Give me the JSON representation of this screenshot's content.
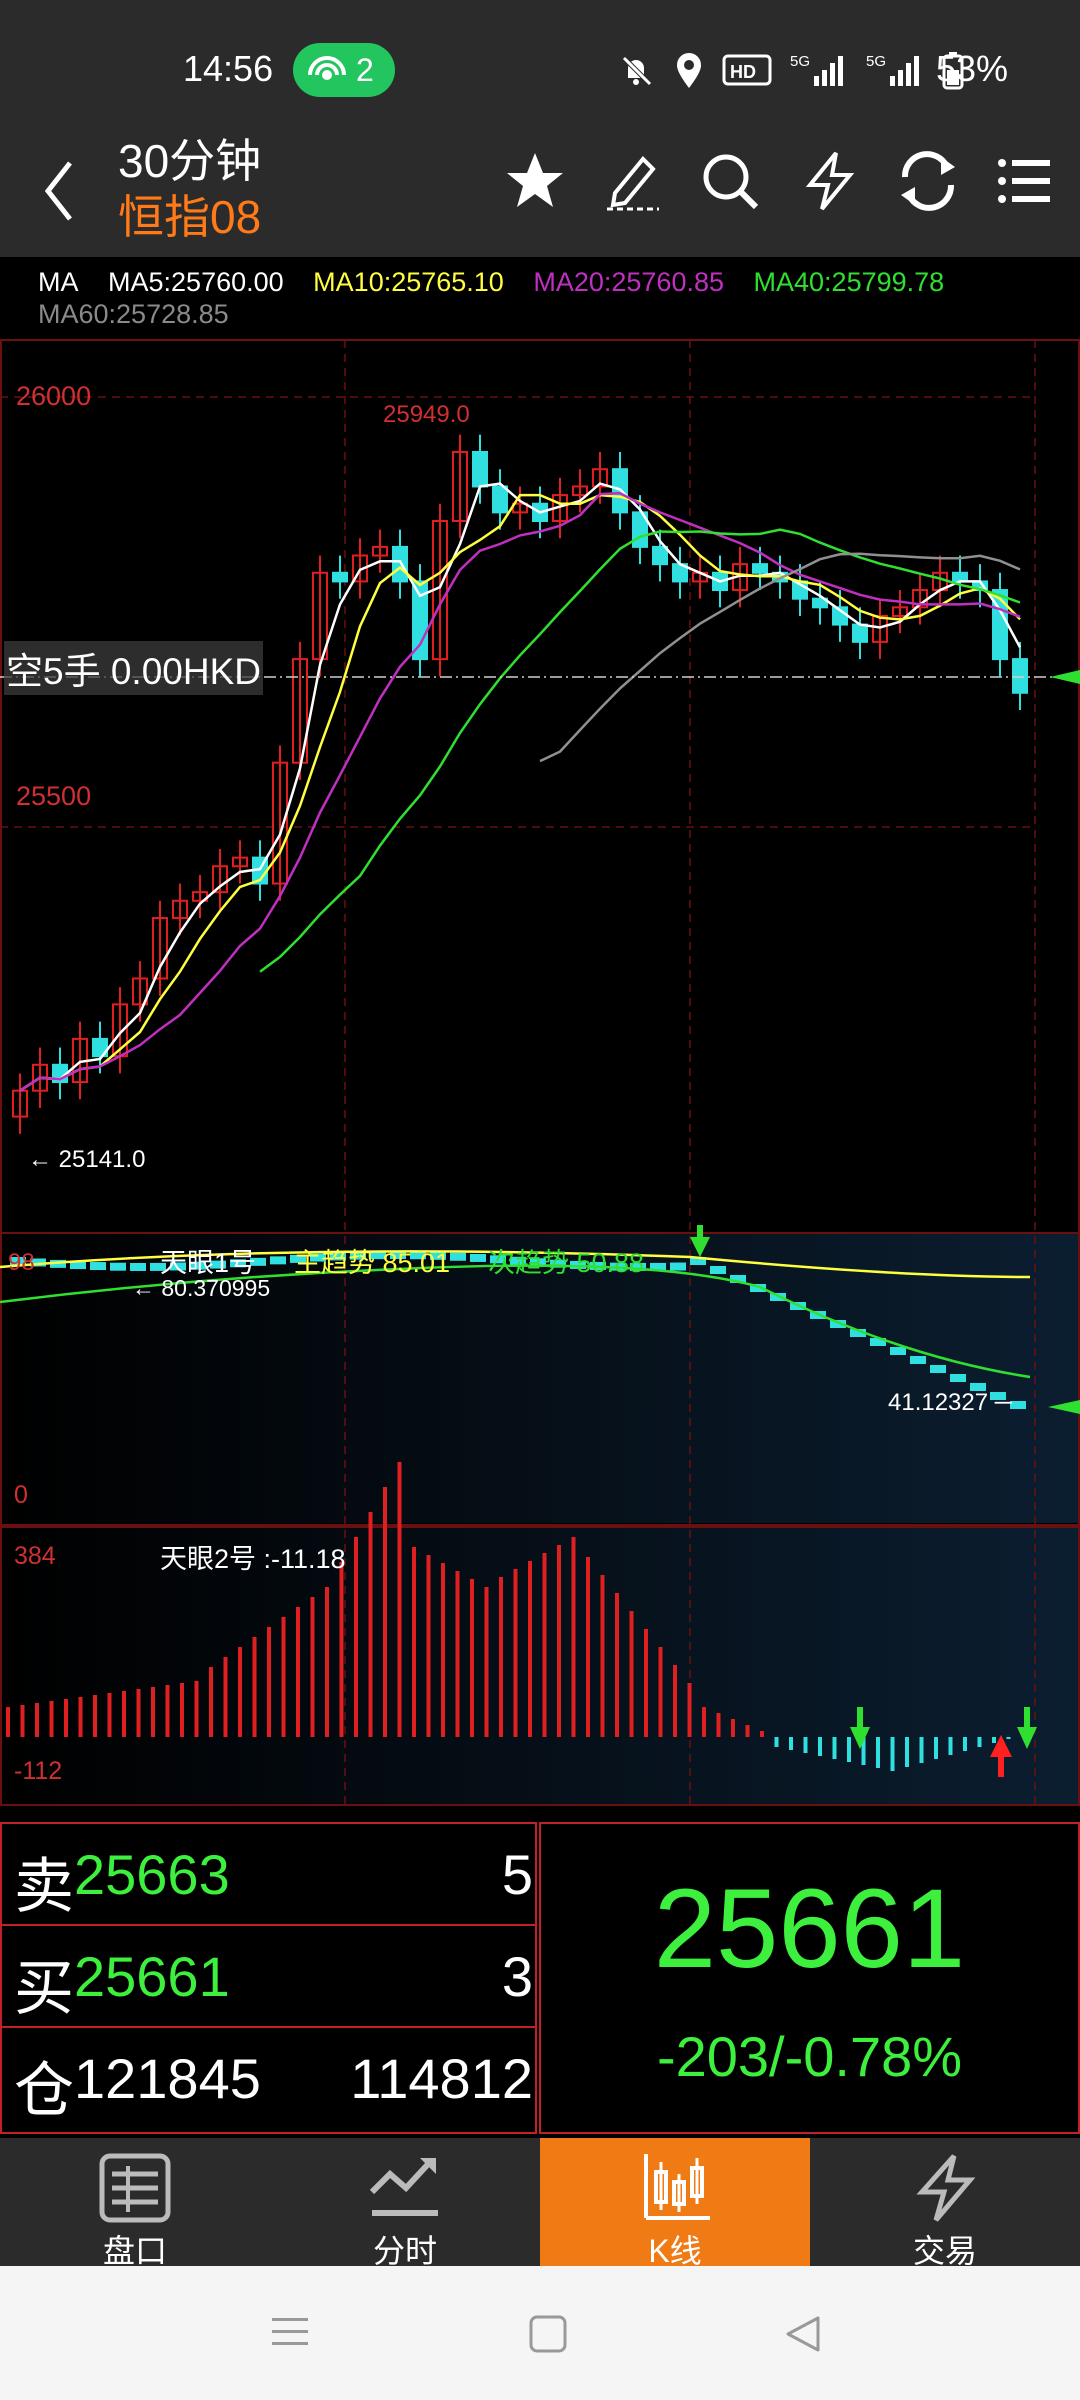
{
  "status_bar": {
    "time": "14:56",
    "hotspot_count": "2",
    "network": "HD 5G 5G",
    "battery": "53%"
  },
  "header": {
    "title": "30分钟",
    "subtitle": "恒指08"
  },
  "ma_legend": {
    "label": "MA",
    "ma5": "MA5:25760.00",
    "ma10": "MA10:25765.10",
    "ma20": "MA20:25760.85",
    "ma40": "MA40:25799.78",
    "ma60": "MA60:25728.85",
    "colors": {
      "ma5": "#ffffff",
      "ma10": "#ffff40",
      "ma20": "#c030c0",
      "ma40": "#30e030",
      "ma60": "#909090"
    }
  },
  "main_chart": {
    "y_top_label": "26000",
    "y_mid_label": "25500",
    "high_label": "25949.0",
    "low_label": "← 25141.0",
    "position_text": "空5手  0.00HKD"
  },
  "indicator1": {
    "title": "天眼1号",
    "main_trend": "主趋势 85.01",
    "sub_trend": "次趋势 50.88",
    "left_value": "98",
    "marker_value": "← 80.370995",
    "right_value": "41.12327 ─",
    "zero": "0"
  },
  "indicator2": {
    "title": "天眼2号 :-11.18",
    "top": "384",
    "bottom": "-112"
  },
  "quote": {
    "sell_label": "卖",
    "sell_price": "25663",
    "sell_vol": "5",
    "buy_label": "买",
    "buy_price": "25661",
    "buy_vol": "3",
    "oi_label": "仓",
    "oi_value1": "121845",
    "oi_value2": "114812",
    "last_price": "25661",
    "change": "-203/-0.78%"
  },
  "tabs": [
    {
      "label": "盘口",
      "icon": "orderbook-icon"
    },
    {
      "label": "分时",
      "icon": "timeshare-icon"
    },
    {
      "label": "K线",
      "icon": "candlestick-icon",
      "active": true
    },
    {
      "label": "交易",
      "icon": "lightning-icon"
    }
  ],
  "chart_data": {
    "type": "candlestick",
    "interval": "30分钟",
    "symbol": "恒指08",
    "ylim": [
      25100,
      26050
    ],
    "high": 25949.0,
    "low": 25141.0,
    "last": 25661,
    "candles_approx_close": [
      25200,
      25230,
      25210,
      25260,
      25240,
      25300,
      25330,
      25400,
      25420,
      25430,
      25460,
      25470,
      25440,
      25580,
      25700,
      25800,
      25790,
      25820,
      25830,
      25790,
      25700,
      25860,
      25940,
      25900,
      25870,
      25880,
      25860,
      25890,
      25900,
      25920,
      25870,
      25830,
      25810,
      25790,
      25800,
      25780,
      25810,
      25800,
      25790,
      25770,
      25760,
      25740,
      25720,
      25750,
      25760,
      25780,
      25800,
      25790,
      25780,
      25700,
      25661
    ],
    "indicator1": {
      "title": "天眼1号",
      "main_trend": 85.01,
      "sub_trend": 50.88,
      "last": 41.12327
    },
    "indicator2": {
      "title": "天眼2号",
      "value": -11.18,
      "ylim": [
        -112,
        384
      ]
    }
  }
}
